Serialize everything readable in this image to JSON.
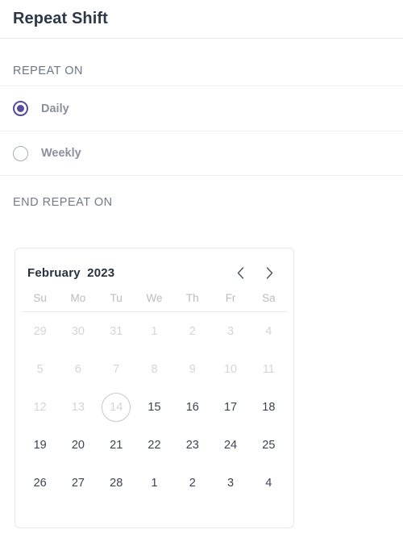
{
  "header": {
    "title": "Repeat Shift"
  },
  "repeat_on": {
    "label": "REPEAT ON",
    "options": [
      {
        "label": "Daily",
        "selected": true
      },
      {
        "label": "Weekly",
        "selected": false
      }
    ]
  },
  "end_repeat_on": {
    "label": "END REPEAT ON"
  },
  "calendar": {
    "month": "February",
    "year": "2023",
    "title": "February  2023",
    "prev_icon": "chevron-left-icon",
    "next_icon": "chevron-right-icon",
    "weekdays": [
      "Su",
      "Mo",
      "Tu",
      "We",
      "Th",
      "Fr",
      "Sa"
    ],
    "weeks": [
      [
        {
          "day": "29",
          "disabled": true,
          "today": false
        },
        {
          "day": "30",
          "disabled": true,
          "today": false
        },
        {
          "day": "31",
          "disabled": true,
          "today": false
        },
        {
          "day": "1",
          "disabled": true,
          "today": false
        },
        {
          "day": "2",
          "disabled": true,
          "today": false
        },
        {
          "day": "3",
          "disabled": true,
          "today": false
        },
        {
          "day": "4",
          "disabled": true,
          "today": false
        }
      ],
      [
        {
          "day": "5",
          "disabled": true,
          "today": false
        },
        {
          "day": "6",
          "disabled": true,
          "today": false
        },
        {
          "day": "7",
          "disabled": true,
          "today": false
        },
        {
          "day": "8",
          "disabled": true,
          "today": false
        },
        {
          "day": "9",
          "disabled": true,
          "today": false
        },
        {
          "day": "10",
          "disabled": true,
          "today": false
        },
        {
          "day": "11",
          "disabled": true,
          "today": false
        }
      ],
      [
        {
          "day": "12",
          "disabled": true,
          "today": false
        },
        {
          "day": "13",
          "disabled": true,
          "today": false
        },
        {
          "day": "14",
          "disabled": true,
          "today": true
        },
        {
          "day": "15",
          "disabled": false,
          "today": false
        },
        {
          "day": "16",
          "disabled": false,
          "today": false
        },
        {
          "day": "17",
          "disabled": false,
          "today": false
        },
        {
          "day": "18",
          "disabled": false,
          "today": false
        }
      ],
      [
        {
          "day": "19",
          "disabled": false,
          "today": false
        },
        {
          "day": "20",
          "disabled": false,
          "today": false
        },
        {
          "day": "21",
          "disabled": false,
          "today": false
        },
        {
          "day": "22",
          "disabled": false,
          "today": false
        },
        {
          "day": "23",
          "disabled": false,
          "today": false
        },
        {
          "day": "24",
          "disabled": false,
          "today": false
        },
        {
          "day": "25",
          "disabled": false,
          "today": false
        }
      ],
      [
        {
          "day": "26",
          "disabled": false,
          "today": false
        },
        {
          "day": "27",
          "disabled": false,
          "today": false
        },
        {
          "day": "28",
          "disabled": false,
          "today": false
        },
        {
          "day": "1",
          "disabled": false,
          "today": false
        },
        {
          "day": "2",
          "disabled": false,
          "today": false
        },
        {
          "day": "3",
          "disabled": false,
          "today": false
        },
        {
          "day": "4",
          "disabled": false,
          "today": false
        }
      ]
    ]
  },
  "colors": {
    "accent": "#574ba0",
    "title_text": "#2d3748",
    "label_text": "#6d7685",
    "day_text": "#3a4453",
    "day_disabled": "#d3d5d9",
    "border": "#e7e9ec"
  }
}
